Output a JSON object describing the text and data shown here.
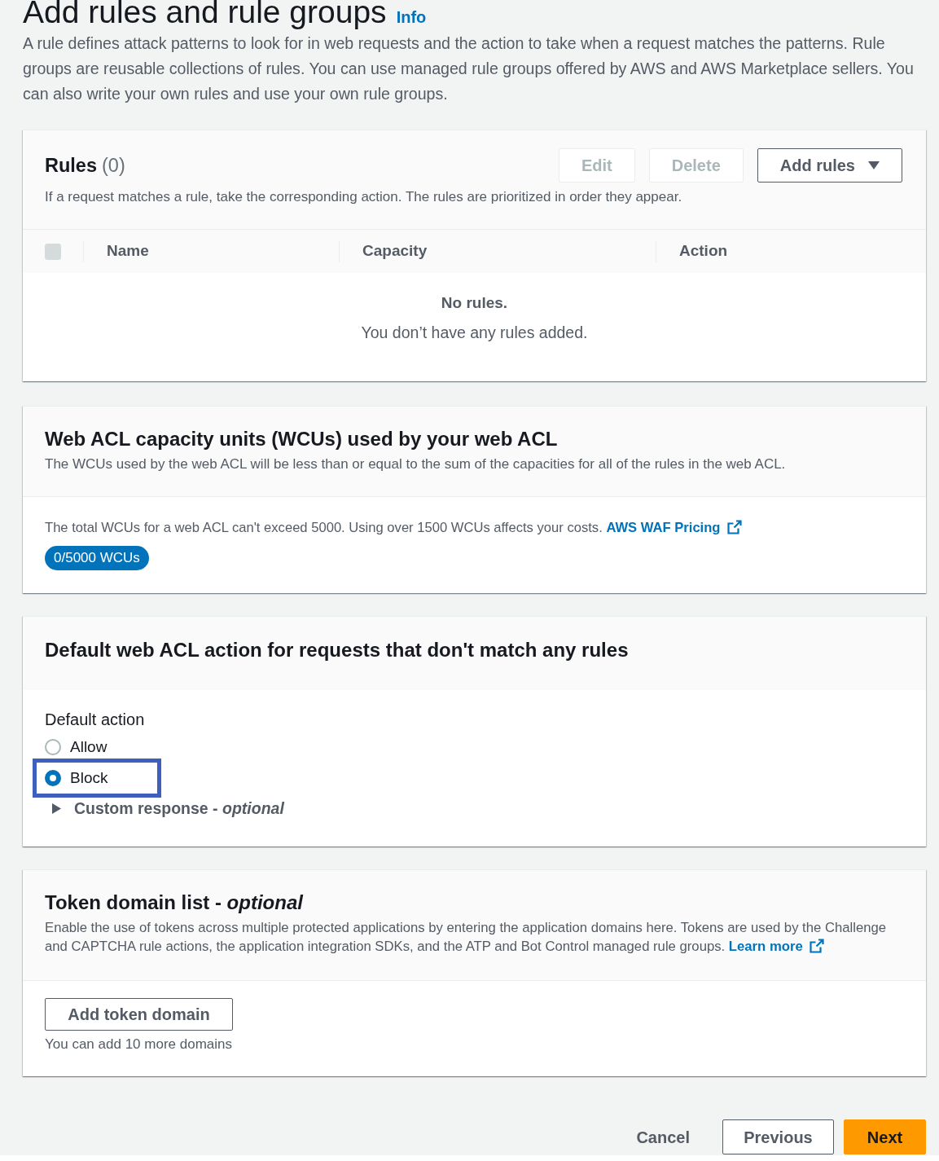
{
  "page": {
    "title": "Add rules and rule groups",
    "info_link": "Info",
    "description": "A rule defines attack patterns to look for in web requests and the action to take when a request matches the patterns. Rule groups are reusable collections of rules. You can use managed rule groups offered by AWS and AWS Marketplace sellers. You can also write your own rules and use your own rule groups."
  },
  "rules_panel": {
    "title": "Rules",
    "count": "(0)",
    "description": "If a request matches a rule, take the corresponding action. The rules are prioritized in order they appear.",
    "buttons": [
      {
        "label": "Edit",
        "kind": "plain",
        "disabled": true
      },
      {
        "label": "Delete",
        "kind": "plain",
        "disabled": true
      },
      {
        "label": "Add rules",
        "kind": "dropdown",
        "disabled": false
      }
    ],
    "table": {
      "select_all": {
        "checked": false,
        "disabled": true
      },
      "columns": [
        "Name",
        "Capacity",
        "Action"
      ],
      "empty_title": "No rules.",
      "empty_message": "You don’t have any rules added."
    }
  },
  "wcu_panel": {
    "title": "Web ACL capacity units (WCUs) used by your web ACL",
    "description": "The WCUs used by the web ACL will be less than or equal to the sum of the capacities for all of the rules in the web ACL.",
    "note": "The total WCUs for a web ACL can't exceed 5000. Using over 1500 WCUs affects your costs.",
    "link": "AWS WAF Pricing",
    "badge": "0/5000 WCUs"
  },
  "default_action_panel": {
    "title": "Default web ACL action for requests that don't match any rules",
    "field_label": "Default action",
    "options": [
      {
        "label": "Allow",
        "selected": false,
        "highlighted": false
      },
      {
        "label": "Block",
        "selected": true,
        "highlighted": true
      }
    ],
    "custom_response": {
      "label": "Custom response - *optional*",
      "expanded": false
    }
  },
  "token_panel": {
    "title": "Token domain list - *optional*",
    "description": "Enable the use of tokens across multiple protected applications by entering the application domains here. Tokens are used by the Challenge and CAPTCHA rule actions, the application integration SDKs, and the ATP and Bot Control managed rule groups.",
    "link": "Learn more",
    "button": "Add token domain",
    "hint": "You can add 10 more domains"
  },
  "footer": {
    "buttons": [
      {
        "label": "Cancel",
        "kind": "link"
      },
      {
        "label": "Previous",
        "kind": "secondary"
      },
      {
        "label": "Next",
        "kind": "primary"
      }
    ]
  }
}
